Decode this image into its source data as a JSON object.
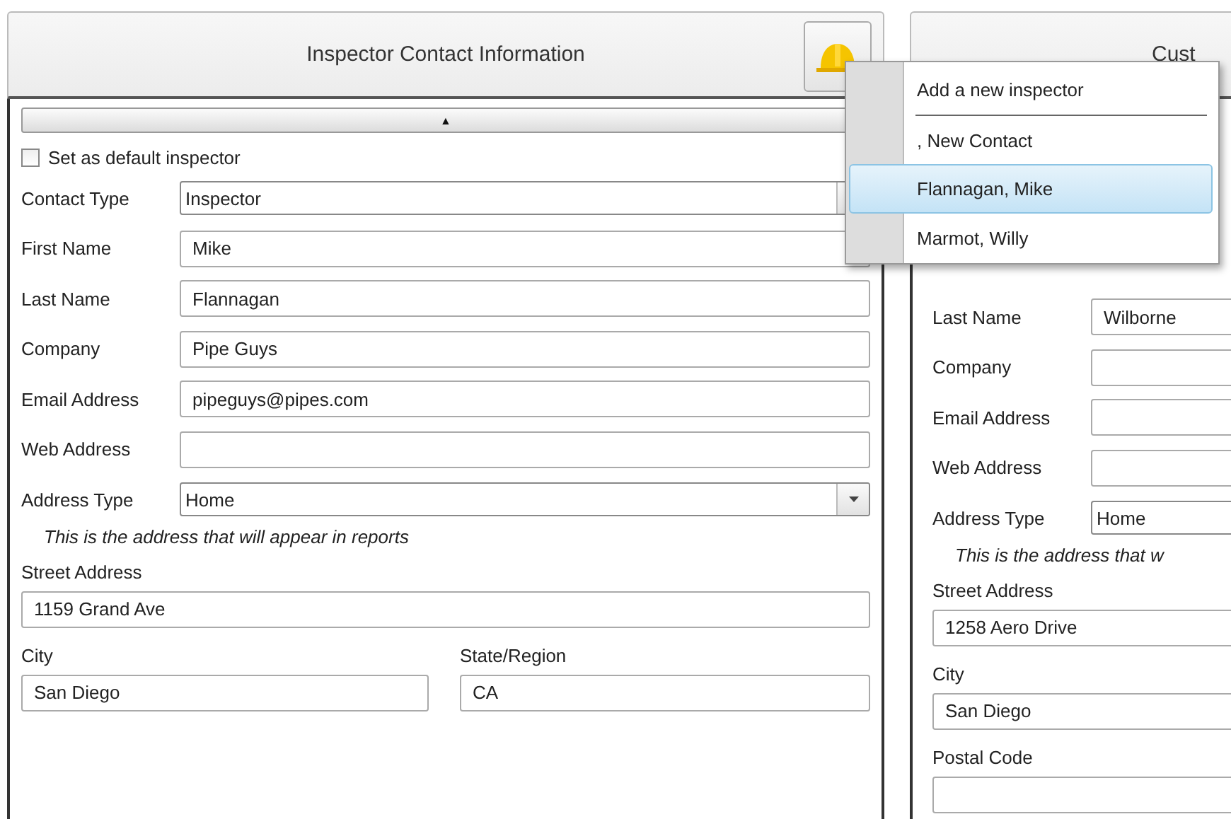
{
  "inspector_panel": {
    "title": "Inspector Contact Information",
    "collapse_toggle": "▲",
    "default_checkbox": {
      "label": "Set as default inspector",
      "checked": false
    },
    "fields": [
      {
        "kind": "combo",
        "label": "Contact Type",
        "value": "Inspector"
      },
      {
        "kind": "text",
        "label": "First Name",
        "value": "Mike"
      },
      {
        "kind": "text",
        "label": "Last Name",
        "value": "Flannagan"
      },
      {
        "kind": "text",
        "label": "Company",
        "value": "Pipe Guys"
      },
      {
        "kind": "text",
        "label": "Email Address",
        "value": "pipeguys@pipes.com"
      },
      {
        "kind": "text",
        "label": "Web Address"
      },
      {
        "kind": "combo",
        "label": "Address Type",
        "value": "Home"
      }
    ],
    "note": "This is the address that will appear in reports",
    "street": {
      "label": "Street Address",
      "value": "1159 Grand Ave"
    },
    "city": {
      "label": "City",
      "value": "San Diego"
    },
    "state": {
      "label": "State/Region",
      "value": "CA"
    }
  },
  "customer_panel": {
    "title": "Cust",
    "fields": [
      {
        "kind": "text",
        "label": "Last Name",
        "value": "Wilborne"
      },
      {
        "kind": "text",
        "label": "Company"
      },
      {
        "kind": "text",
        "label": "Email Address"
      },
      {
        "kind": "text",
        "label": "Web Address"
      },
      {
        "kind": "combo",
        "label": "Address Type",
        "value": "Home"
      }
    ],
    "note": "This is the address that w",
    "street": {
      "label": "Street Address",
      "value": "1258 Aero Drive"
    },
    "city": {
      "label": "City",
      "value": "San Diego"
    },
    "postal_code": {
      "label": "Postal Code"
    }
  },
  "inspector_menu": {
    "items": [
      {
        "kind": "action",
        "label": "Add a new inspector",
        "selected": false
      },
      {
        "kind": "contact",
        "label": ", New Contact",
        "selected": false
      },
      {
        "kind": "contact",
        "label": "Flannagan, Mike",
        "selected": true
      },
      {
        "kind": "contact",
        "label": "Marmot, Willy",
        "selected": false
      }
    ]
  }
}
